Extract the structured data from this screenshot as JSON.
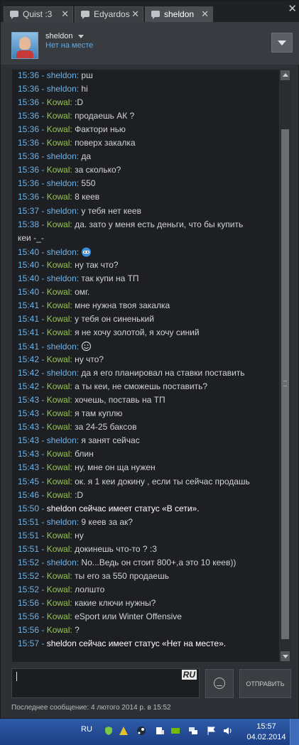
{
  "tabs": [
    {
      "label": "Quist :3",
      "active": false
    },
    {
      "label": "Edyardos",
      "active": false
    },
    {
      "label": "sheldon",
      "active": true
    }
  ],
  "window_close": "✕",
  "header": {
    "username": "sheldon",
    "status": "Нет на месте"
  },
  "messages": [
    {
      "time": "15:36",
      "name": "sheldon",
      "text": "рш"
    },
    {
      "time": "15:36",
      "name": "sheldon",
      "text": "hi"
    },
    {
      "time": "15:36",
      "name": "Kowal",
      "text": ":D"
    },
    {
      "time": "15:36",
      "name": "Kowal",
      "text": "продаешь АК ?"
    },
    {
      "time": "15:36",
      "name": "Kowal",
      "text": "Фактори нью"
    },
    {
      "time": "15:36",
      "name": "Kowal",
      "text": "поверх закалка"
    },
    {
      "time": "15:36",
      "name": "sheldon",
      "text": "да"
    },
    {
      "time": "15:36",
      "name": "Kowal",
      "text": "за сколько?"
    },
    {
      "time": "15:36",
      "name": "sheldon",
      "text": "550"
    },
    {
      "time": "15:36",
      "name": "Kowal",
      "text": "8 кеев"
    },
    {
      "time": "15:37",
      "name": "sheldon",
      "text": "у тебя нет кеев"
    },
    {
      "time": "15:38",
      "name": "Kowal",
      "text": "да. зато у меня есть деньги, что бы купить",
      "cont": "кеи -_-"
    },
    {
      "time": "15:40",
      "name": "sheldon",
      "text": "",
      "emoji": "blue-face"
    },
    {
      "time": "15:40",
      "name": "Kowal",
      "text": "ну так что?"
    },
    {
      "time": "15:40",
      "name": "sheldon",
      "text": "так купи на ТП"
    },
    {
      "time": "15:40",
      "name": "Kowal",
      "text": "омг."
    },
    {
      "time": "15:41",
      "name": "Kowal",
      "text": "мне нужна твоя закалка"
    },
    {
      "time": "15:41",
      "name": "Kowal",
      "text": "у тебя он синенький"
    },
    {
      "time": "15:41",
      "name": "Kowal",
      "text": "я не хочу золотой, я хочу синий"
    },
    {
      "time": "15:41",
      "name": "sheldon",
      "text": "",
      "emoji": "smiley"
    },
    {
      "time": "15:42",
      "name": "Kowal",
      "text": "ну что?"
    },
    {
      "time": "15:42",
      "name": "sheldon",
      "text": "да я его планировал на ставки поставить"
    },
    {
      "time": "15:42",
      "name": "Kowal",
      "text": "а ты кеи, не сможешь поставить?"
    },
    {
      "time": "15:43",
      "name": "Kowal",
      "text": "хочешь, поставь на ТП"
    },
    {
      "time": "15:43",
      "name": "Kowal",
      "text": "я там куплю"
    },
    {
      "time": "15:43",
      "name": "Kowal",
      "text": "за 24-25 баксов"
    },
    {
      "time": "15:43",
      "name": "sheldon",
      "text": "я занят сейчас"
    },
    {
      "time": "15:43",
      "name": "Kowal",
      "text": "блин"
    },
    {
      "time": "15:43",
      "name": "Kowal",
      "text": "ну, мне он ща нужен"
    },
    {
      "time": "15:45",
      "name": "Kowal",
      "text": "ок. я 1 кеи докину , если ты сейчас продашь"
    },
    {
      "time": "15:46",
      "name": "Kowal",
      "text": ":D"
    },
    {
      "time": "15:50",
      "system": "sheldon сейчас имеет статус «В сети»."
    },
    {
      "time": "15:51",
      "name": "sheldon",
      "text": "9 кеев за ак?"
    },
    {
      "time": "15:51",
      "name": "Kowal",
      "text": "ну"
    },
    {
      "time": "15:51",
      "name": "Kowal",
      "text": "докинешь что-то ? :3"
    },
    {
      "time": "15:52",
      "name": "sheldon",
      "text": "No...Ведь он стоит 800+,а это 10 кеев))"
    },
    {
      "time": "15:52",
      "name": "Kowal",
      "text": "ты его за 550 продаешь"
    },
    {
      "time": "15:52",
      "name": "Kowal",
      "text": "лолшто"
    },
    {
      "time": "15:56",
      "name": "Kowal",
      "text": "какие ключи нужны?"
    },
    {
      "time": "15:56",
      "name": "Kowal",
      "text": "eSport или Winter Offensive"
    },
    {
      "time": "15:56",
      "name": "Kowal",
      "text": "?"
    },
    {
      "time": "15:57",
      "system": "sheldon сейчас имеет статус «Нет на месте»."
    }
  ],
  "input": {
    "value": "",
    "layout_badge": "RU"
  },
  "send_label": "ОТПРАВИТЬ",
  "last_message": "Последнее сообщение: 4 лютого 2014 р. в 15:52",
  "taskbar": {
    "language": "RU",
    "time": "15:57",
    "date": "04.02.2014"
  },
  "colors": {
    "time": "#6eb3e8",
    "sheldon": "#6eb3e8",
    "kowal": "#97c94a",
    "message": "#d2d3d4",
    "system": "#ffffff"
  }
}
